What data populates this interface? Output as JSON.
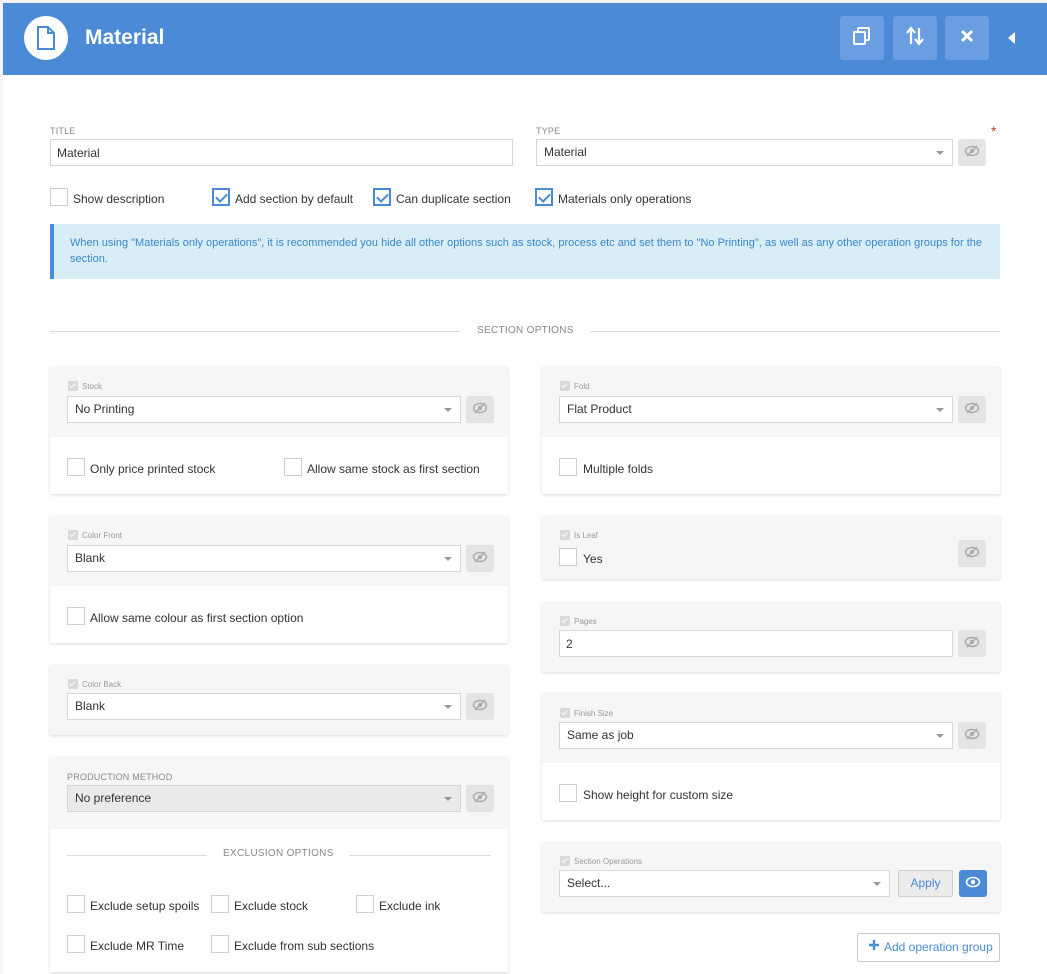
{
  "header": {
    "title": "Material"
  },
  "form": {
    "title_label": "TITLE",
    "title_value": "Material",
    "type_label": "TYPE",
    "type_value": "Material",
    "required_marker": "*",
    "checkboxes": [
      {
        "label": "Show description",
        "checked": false
      },
      {
        "label": "Add section by default",
        "checked": true
      },
      {
        "label": "Can duplicate section",
        "checked": true
      },
      {
        "label": "Materials only operations",
        "checked": true
      }
    ],
    "info_text": "When using \"Materials only operations\", it is recommended you hide all other options such as stock, process etc and set them to \"No Printing\", as well as any other operation groups for the section."
  },
  "section_options_heading": "SECTION OPTIONS",
  "left": {
    "stock": {
      "label": "Stock",
      "value": "No Printing",
      "options": [
        {
          "label": "Only price printed stock",
          "checked": false
        },
        {
          "label": "Allow same stock as first section",
          "checked": false
        }
      ]
    },
    "color_front": {
      "label": "Color Front",
      "value": "Blank",
      "options": [
        {
          "label": "Allow same colour as first section option",
          "checked": false
        }
      ]
    },
    "color_back": {
      "label": "Color Back",
      "value": "Blank"
    },
    "production_method": {
      "label": "PRODUCTION METHOD",
      "value": "No preference"
    },
    "exclusion_heading": "EXCLUSION OPTIONS",
    "exclusions": [
      {
        "label": "Exclude setup spoils",
        "checked": false
      },
      {
        "label": "Exclude stock",
        "checked": false
      },
      {
        "label": "Exclude ink",
        "checked": false
      },
      {
        "label": "Exclude MR Time",
        "checked": false
      },
      {
        "label": "Exclude from sub sections",
        "checked": false
      }
    ]
  },
  "right": {
    "fold": {
      "label": "Fold",
      "value": "Flat Product",
      "option": "Multiple folds"
    },
    "is_leaf": {
      "label": "Is Leaf",
      "option": "Yes"
    },
    "pages": {
      "label": "Pages",
      "value": "2"
    },
    "finish_size": {
      "label": "Finish Size",
      "value": "Same as job",
      "option": "Show height for custom size"
    },
    "section_operations": {
      "label": "Section Operations",
      "value": "Select...",
      "apply_label": "Apply"
    },
    "add_group_label": "Add operation group"
  },
  "colors": {
    "accent": "#4a8ad6",
    "info_bg": "#d9edf7",
    "required": "#c0392b"
  },
  "icons": [
    "document-icon",
    "duplicate-icon",
    "sort-icon",
    "close-icon",
    "collapse-icon",
    "eye-slash-icon",
    "eye-icon",
    "plus-icon"
  ]
}
